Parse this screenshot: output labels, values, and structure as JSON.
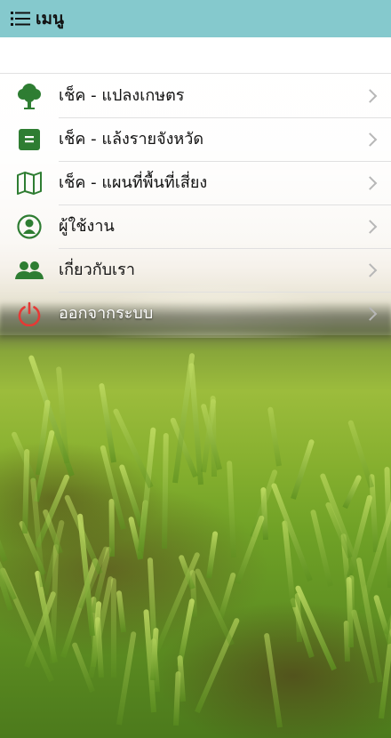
{
  "header": {
    "menu_icon": "hamburger-list-icon",
    "title": "เมนู",
    "background_color": "#85c9cd"
  },
  "menu": {
    "items": [
      {
        "label": "เช็ค - แปลงเกษตร",
        "icon": "tree-icon",
        "icon_color": "#2e7d32"
      },
      {
        "label": "เช็ค - แล้งรายจังหวัด",
        "icon": "list-box-icon",
        "icon_color": "#2e7d32"
      },
      {
        "label": "เช็ค - แผนที่พื้นที่เสี่ยง",
        "icon": "map-icon",
        "icon_color": "#2e7d32"
      },
      {
        "label": "ผู้ใช้งาน",
        "icon": "user-circle-icon",
        "icon_color": "#2e7d32"
      },
      {
        "label": "เกี่ยวกับเรา",
        "icon": "group-icon",
        "icon_color": "#2e7d32"
      },
      {
        "label": "ออกจากระบบ",
        "icon": "power-icon",
        "icon_color": "#e53935"
      }
    ],
    "chevron_icon": "chevron-right-icon"
  }
}
